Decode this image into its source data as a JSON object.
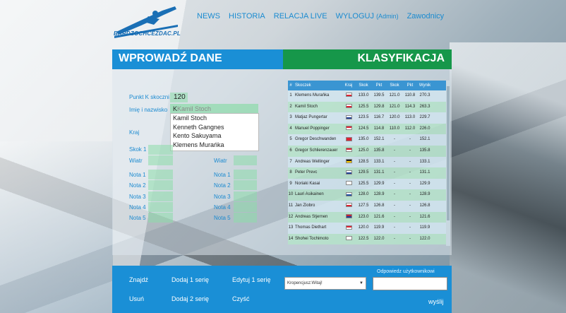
{
  "site": {
    "logo_text": "BARDZOCHCEZDAC.PL"
  },
  "nav": [
    {
      "label": "NEWS"
    },
    {
      "label": "HISTORIA"
    },
    {
      "label": "RELACJA LIVE"
    },
    {
      "label": "WYLOGUJ",
      "suffix": "(Admin)"
    },
    {
      "label": "Zawodnicy"
    }
  ],
  "left": {
    "title": "WPROWADŹ DANE",
    "punkt_label": "Punkt K skoczni",
    "punkt_value": "120",
    "name_label": "Imię i nazwisko",
    "name_typed": "K",
    "name_suggest": "Kamil Stoch",
    "kraj_label": "Kraj",
    "skok1_label": "Skok 1",
    "wiatr_label": "Wiatr",
    "nota_labels": [
      "Nota 1",
      "Nota 2",
      "Nota 3",
      "Nota 4",
      "Nota 5"
    ],
    "suggestions": [
      "Kamil Stoch",
      "Kenneth Gangnes",
      "Kento Sakuyama",
      "Klemens Murańka"
    ]
  },
  "right": {
    "title": "KLASYFIKACJA",
    "headers": [
      "#",
      "Skoczek",
      "Kraj",
      "Skok",
      "Pkt",
      "Skok",
      "Pkt",
      "Wynik"
    ],
    "rows": [
      [
        "1",
        "Klemens Murańka",
        "POL",
        "133.0",
        "139.5",
        "121.0",
        "110.8",
        "270.3"
      ],
      [
        "2",
        "Kamil Stoch",
        "POL",
        "125.5",
        "129.8",
        "121.0",
        "114.3",
        "263.3"
      ],
      [
        "3",
        "Matjaz Pungertar",
        "SLO",
        "123.5",
        "116.7",
        "120.0",
        "113.0",
        "229.7"
      ],
      [
        "4",
        "Manuel Poppinger",
        "AUT",
        "124.5",
        "114.8",
        "110.0",
        "112.0",
        "226.0"
      ],
      [
        "5",
        "Gregor Deschwanden",
        "SUI",
        "135.0",
        "152.1",
        "-",
        "-",
        "152.1"
      ],
      [
        "6",
        "Gregor Schlierenzauer",
        "AUT",
        "125.0",
        "135.8",
        "-",
        "-",
        "135.8"
      ],
      [
        "7",
        "Andreas Wellinger",
        "GER",
        "128.5",
        "133.1",
        "-",
        "-",
        "133.1"
      ],
      [
        "8",
        "Peter Prevc",
        "SLO",
        "129.5",
        "131.1",
        "-",
        "-",
        "131.1"
      ],
      [
        "9",
        "Noriaki Kasai",
        "JPN",
        "125.5",
        "129.9",
        "-",
        "-",
        "129.9"
      ],
      [
        "10",
        "Lauri Asikainen",
        "FIN",
        "128.0",
        "128.9",
        "-",
        "-",
        "128.9"
      ],
      [
        "11",
        "Jan Ziobro",
        "POL",
        "127.5",
        "126.8",
        "-",
        "-",
        "126.8"
      ],
      [
        "12",
        "Andreas Stjernen",
        "NOR",
        "123.0",
        "121.6",
        "-",
        "-",
        "121.6"
      ],
      [
        "13",
        "Thomas Diethart",
        "AUT",
        "120.0",
        "119.9",
        "-",
        "-",
        "119.9"
      ],
      [
        "14",
        "Shohei Tochimoto",
        "JPN",
        "122.5",
        "122.0",
        "-",
        "-",
        "122.0"
      ]
    ]
  },
  "flags": {
    "POL": [
      "#ffffff",
      "#dd2233"
    ],
    "SLO": [
      "#ffffff",
      "#1c3f94"
    ],
    "AUT": [
      "#dd2233",
      "#ffffff"
    ],
    "SUI": [
      "#dd2233",
      "#dd2233"
    ],
    "GER": [
      "#222222",
      "#ffcc00"
    ],
    "JPN": [
      "#ffffff",
      "#ffffff"
    ],
    "FIN": [
      "#ffffff",
      "#1c4fa0"
    ],
    "NOR": [
      "#cc2233",
      "#1c3f94"
    ]
  },
  "bottom": {
    "znajdz": "Znajdź",
    "dodaj1": "Dodaj 1 serię",
    "edytuj1": "Edytuj 1 serię",
    "usun": "Usuń",
    "dodaj2": "Dodaj 2 serię",
    "czysc": "Czyść",
    "select_value": "Kropencjusz:Witaj!",
    "answer_label": "Odpowiedz użytkownikowi",
    "send": "wyślij"
  }
}
